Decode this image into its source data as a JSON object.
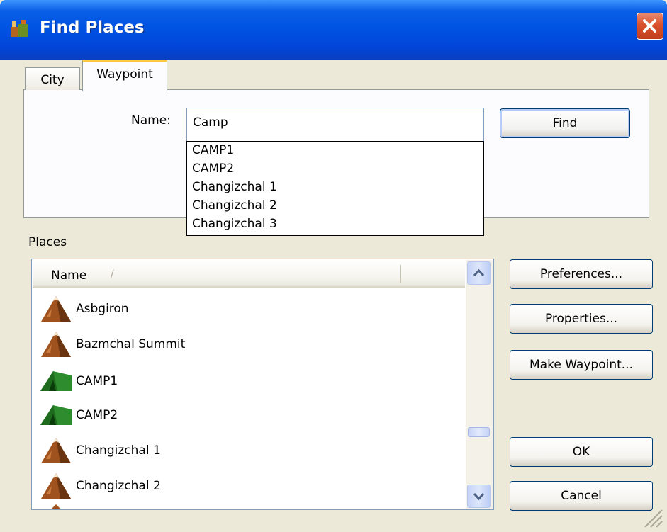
{
  "window": {
    "title": "Find Places"
  },
  "tabs": [
    {
      "label": "City",
      "active": false
    },
    {
      "label": "Waypoint",
      "active": true
    }
  ],
  "search": {
    "name_label": "Name:",
    "value": "Camp",
    "find_label": "Find",
    "suggestions": [
      "CAMP1",
      "CAMP2",
      "Changizchal 1",
      "Changizchal 2",
      "Changizchal 3"
    ]
  },
  "places": {
    "label": "Places",
    "column_header": "Name",
    "sort_indicator": "/",
    "rows": [
      {
        "label": "Asbgiron",
        "icon": "peak-icon"
      },
      {
        "label": "Bazmchal Summit",
        "icon": "peak-icon"
      },
      {
        "label": "CAMP1",
        "icon": "tent-icon"
      },
      {
        "label": "CAMP2",
        "icon": "tent-icon"
      },
      {
        "label": "Changizchal 1",
        "icon": "peak-icon"
      },
      {
        "label": "Changizchal 2",
        "icon": "peak-icon"
      }
    ]
  },
  "buttons": {
    "preferences": "Preferences...",
    "properties": "Properties...",
    "make_waypoint": "Make Waypoint...",
    "ok": "OK",
    "cancel": "Cancel"
  },
  "colors": {
    "titlebar": "#0054E3",
    "dialog_bg": "#ECE9D8",
    "tab_highlight": "#FFC83C",
    "close_button": "#D9502C",
    "tent_green": "#2E8B2E",
    "peak_brown": "#A0521E"
  }
}
